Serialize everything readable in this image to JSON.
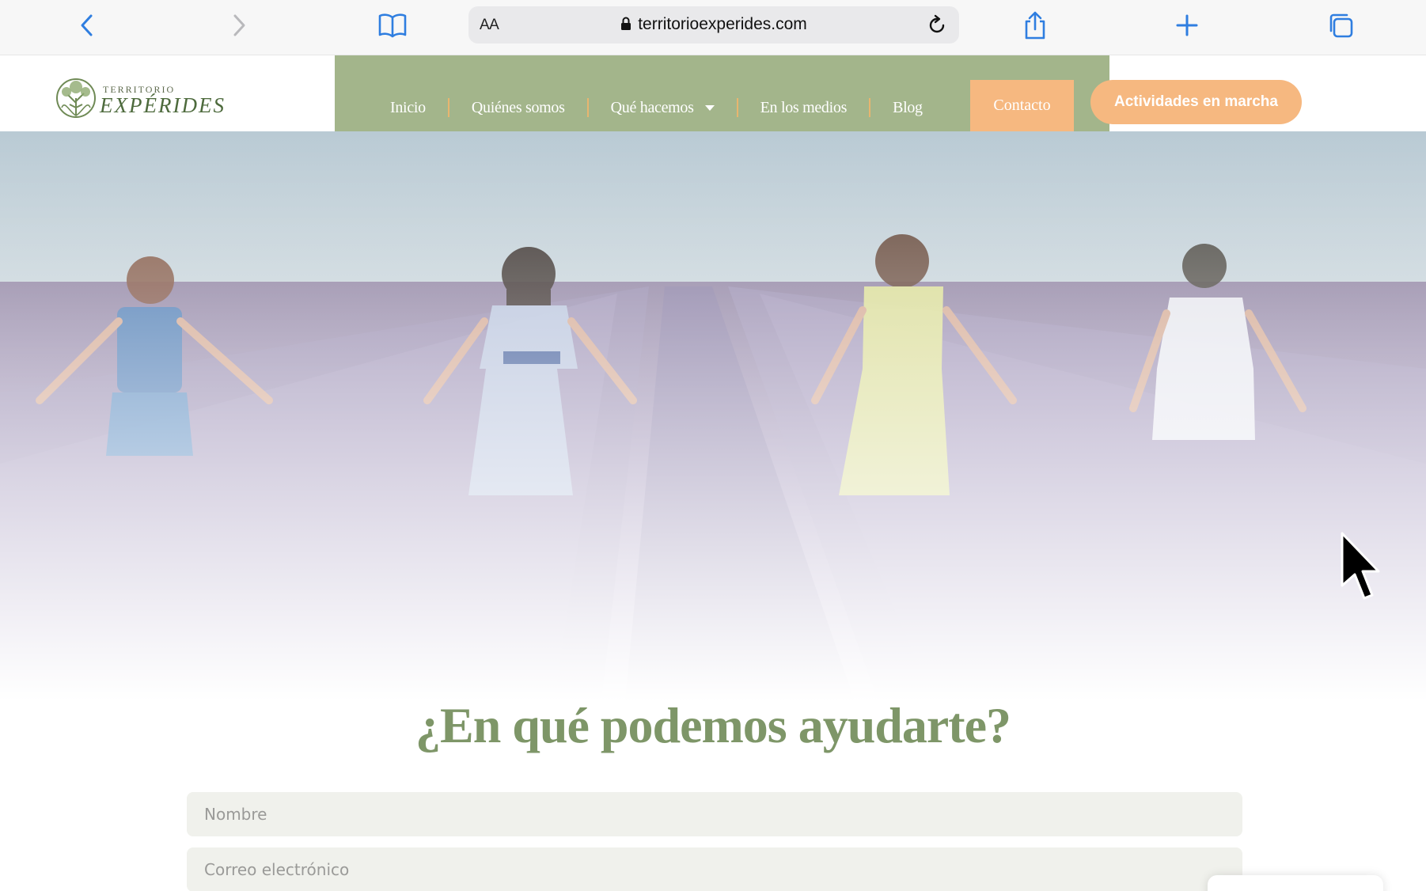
{
  "browser": {
    "text_size_label": "AA",
    "url": "territorioexperides.com",
    "icons": {
      "back": "chevron-left-icon",
      "forward": "chevron-right-icon",
      "bookmarks": "book-icon",
      "reload": "reload-icon",
      "share": "share-icon",
      "new_tab": "plus-icon",
      "tabs": "tabs-icon"
    }
  },
  "site": {
    "logo": {
      "line1": "TERRITORIO",
      "line2": "EXPÉRIDES"
    },
    "nav": {
      "items": [
        {
          "label": "Inicio"
        },
        {
          "label": "Quiénes somos"
        },
        {
          "label": "Qué hacemos",
          "has_dropdown": true
        },
        {
          "label": "En los medios"
        },
        {
          "label": "Blog"
        }
      ],
      "contact_label": "Contacto"
    },
    "cta_label": "Actividades en marcha"
  },
  "contact": {
    "title": "¿En qué podemos ayudarte?",
    "name_placeholder": "Nombre",
    "email_placeholder": "Correo electrónico"
  },
  "colors": {
    "nav_green": "#a3b58b",
    "accent_orange": "#f6b880",
    "title_green": "#7e9668",
    "link_blue": "#2f7ee0"
  }
}
